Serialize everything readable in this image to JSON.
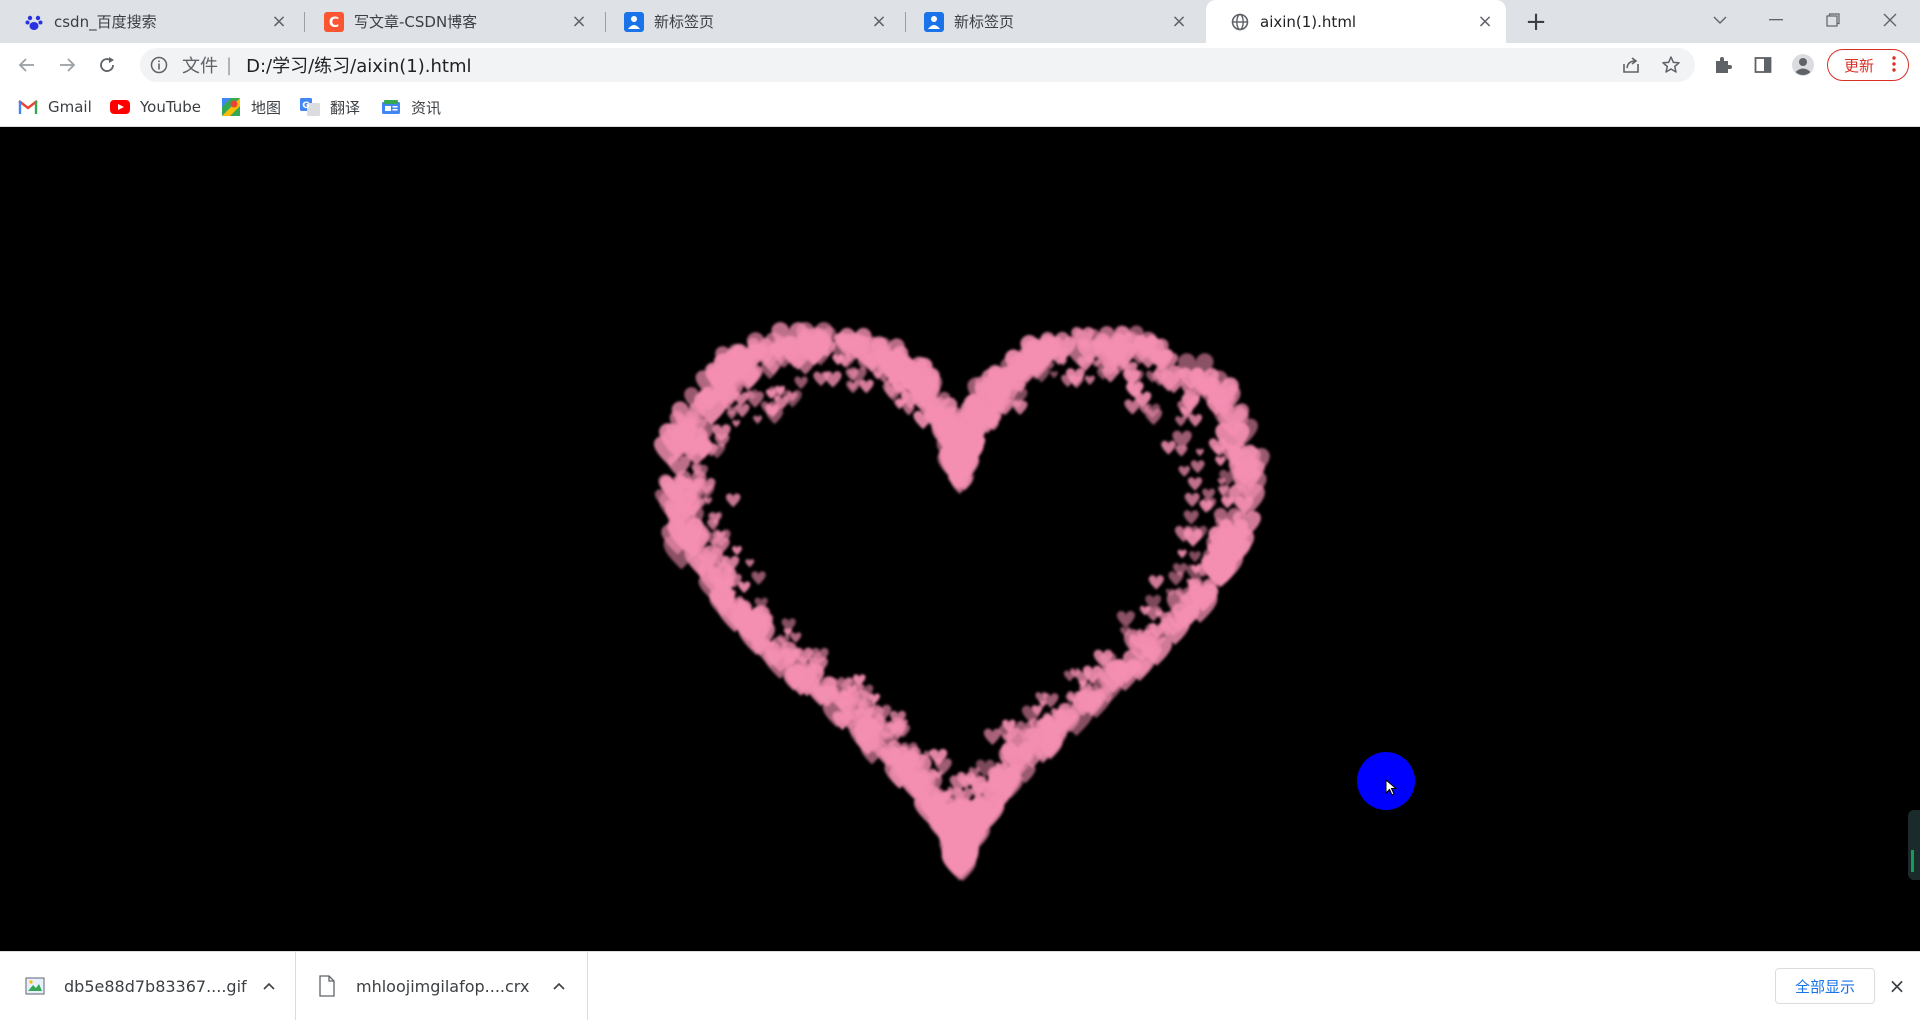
{
  "tabs": [
    {
      "title": "csdn_百度搜索",
      "icon": "baidu-paw-icon"
    },
    {
      "title": "写文章-CSDN博客",
      "icon": "csdn-c-icon"
    },
    {
      "title": "新标签页",
      "icon": "new-tab-page-icon"
    },
    {
      "title": "新标签页",
      "icon": "new-tab-page-icon"
    },
    {
      "title": "aixin(1).html",
      "icon": "globe-icon",
      "active": true
    }
  ],
  "toolbar": {
    "scheme_label": "文件",
    "url": "D:/学习/练习/aixin(1).html",
    "update_label": "更新"
  },
  "bookmarks": [
    {
      "label": "Gmail",
      "icon": "gmail-icon"
    },
    {
      "label": "YouTube",
      "icon": "youtube-icon"
    },
    {
      "label": "地图",
      "icon": "maps-icon"
    },
    {
      "label": "翻译",
      "icon": "translate-icon"
    },
    {
      "label": "资讯",
      "icon": "news-icon"
    }
  ],
  "content": {
    "background_color": "#000000",
    "heart_color": "#f48fb1",
    "cursor_circle_color": "#0000ff"
  },
  "downloads": {
    "items": [
      {
        "filename": "db5e88d7b83367....gif",
        "icon": "image-file-icon"
      },
      {
        "filename": "mhloojimgilafop....crx",
        "icon": "file-icon"
      }
    ],
    "show_all_label": "全部显示"
  }
}
